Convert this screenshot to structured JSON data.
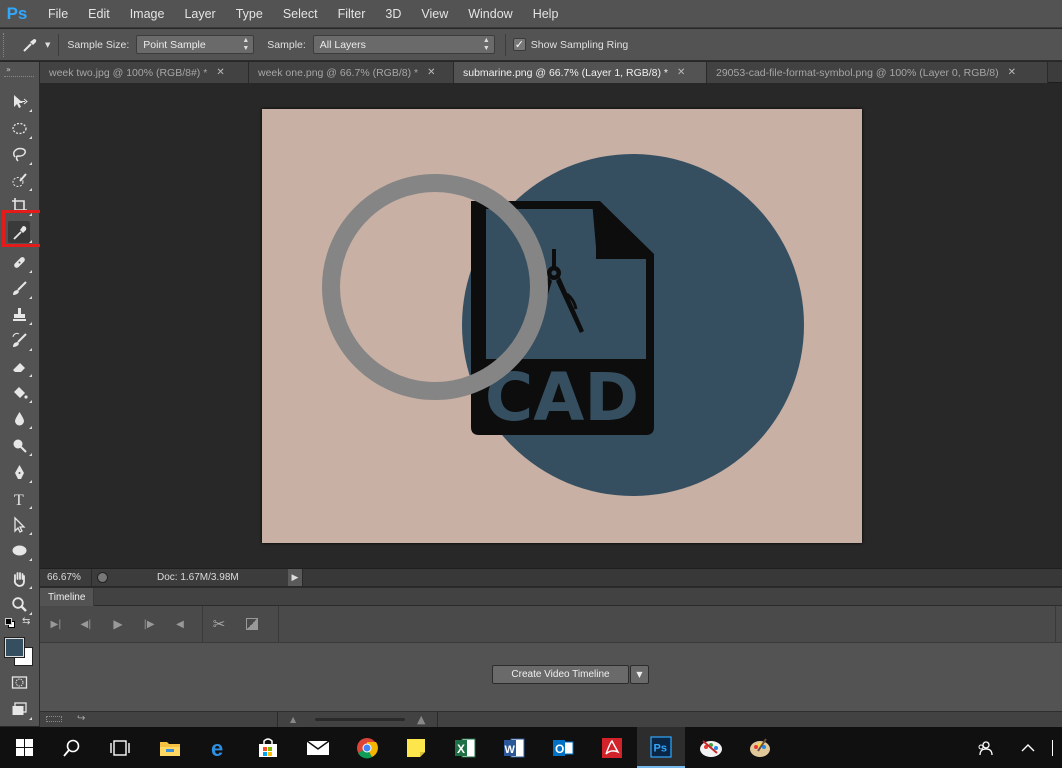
{
  "app": {
    "logo": "Ps"
  },
  "menu": [
    "File",
    "Edit",
    "Image",
    "Layer",
    "Type",
    "Select",
    "Filter",
    "3D",
    "View",
    "Window",
    "Help"
  ],
  "options": {
    "tool_icon": "eyedropper-icon",
    "sample_size_label": "Sample Size:",
    "sample_size_value": "Point Sample",
    "sample_label": "Sample:",
    "sample_value": "All Layers",
    "show_ring_label": "Show Sampling Ring",
    "show_ring_checked": true
  },
  "tabs": [
    {
      "label": "week two.jpg @ 100% (RGB/8#) *",
      "active": false
    },
    {
      "label": "week one.png @ 66.7% (RGB/8) *",
      "active": false
    },
    {
      "label": "submarine.png @ 66.7% (Layer 1, RGB/8) *",
      "active": true
    },
    {
      "label": "29053-cad-file-format-symbol.png @ 100% (Layer 0, RGB/8)",
      "active": false
    }
  ],
  "tools": [
    "move-icon",
    "elliptical-marquee-icon",
    "lasso-icon",
    "quick-selection-icon",
    "crop-icon",
    "eyedropper-icon",
    "healing-brush-icon",
    "brush-icon",
    "clone-stamp-icon",
    "history-brush-icon",
    "eraser-icon",
    "paint-bucket-icon",
    "blur-icon",
    "dodge-icon",
    "pen-icon",
    "type-icon",
    "path-selection-icon",
    "ellipse-shape-icon",
    "hand-icon",
    "zoom-icon"
  ],
  "selected_tool": "eyedropper-icon",
  "document": {
    "background_color": "#c8b0a4",
    "circle_color": "#354f61",
    "ring_color": "#858585",
    "icon_color": "#0d0d0d",
    "icon_text": "CAD"
  },
  "status": {
    "zoom": "66.67%",
    "doc_info": "Doc: 1.67M/3.98M"
  },
  "timeline": {
    "tab_label": "Timeline",
    "create_button": "Create Video Timeline"
  },
  "colors": {
    "foreground": "#354f61",
    "background": "#ffffff",
    "highlight": "#e31b1b",
    "ps_blue": "#31a8ff"
  },
  "taskbar": [
    "windows-start-icon",
    "search-icon",
    "task-view-icon",
    "file-explorer-icon",
    "edge-icon",
    "store-icon",
    "mail-icon",
    "chrome-icon",
    "sticky-notes-icon",
    "excel-icon",
    "word-icon",
    "outlook-icon",
    "acrobat-icon",
    "photoshop-icon",
    "paint-icon",
    "paint-palette-icon"
  ]
}
